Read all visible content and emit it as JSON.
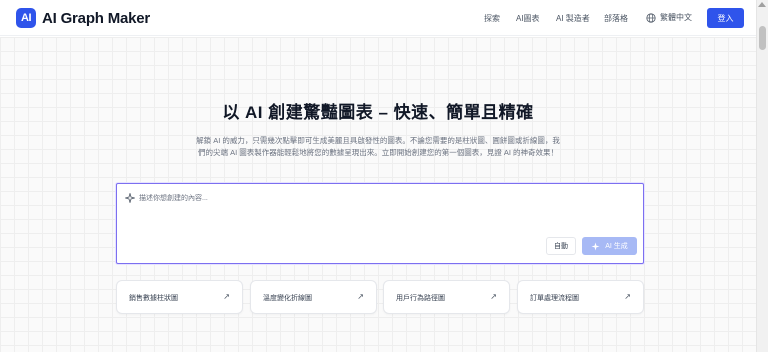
{
  "brand": {
    "logo_mark": "AI",
    "name": "AI Graph Maker",
    "accent": "#2f54eb"
  },
  "nav": {
    "items": [
      "探索",
      "AI圖表",
      "AI 製造者",
      "部落格"
    ],
    "language": "繁體中文",
    "login": "登入"
  },
  "hero": {
    "title": "以 AI 創建驚豔圖表 – 快速、簡單且精確",
    "subtitle_line1": "解鎖 AI 的威力，只需幾次點擊即可生成美麗且具啟發性的圖表。不論您需要的是柱狀圖、圓餅圖或折線圖，我",
    "subtitle_line2": "們的尖端 AI 圖表製作器能輕鬆地將您的數據呈現出來。立即開始創建您的第一個圖表，見證 AI 的神奇效果！"
  },
  "prompt": {
    "placeholder": "描述你想創建的內容...",
    "auto_label": "自動",
    "generate_label": "AI 生成",
    "generate_icon": "sparkle-icon"
  },
  "examples": [
    {
      "label": "銷售數據柱狀圖",
      "icon": "arrow-up-right-icon"
    },
    {
      "label": "溫度變化折線圖",
      "icon": "arrow-up-right-icon"
    },
    {
      "label": "用戶行為路徑圖",
      "icon": "arrow-up-right-icon"
    },
    {
      "label": "訂單處理流程圖",
      "icon": "arrow-up-right-icon"
    }
  ]
}
